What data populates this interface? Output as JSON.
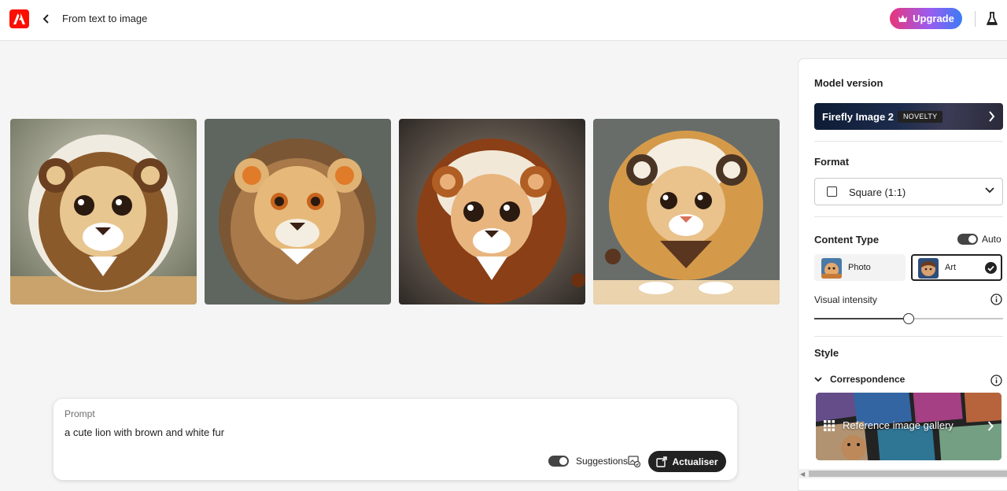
{
  "header": {
    "title": "From text to image",
    "upgrade_label": "Upgrade",
    "brand_color": "#fa0f00"
  },
  "gallery": {
    "images": [
      {
        "name": "lion-image-1"
      },
      {
        "name": "lion-image-2"
      },
      {
        "name": "lion-image-3"
      },
      {
        "name": "lion-image-4"
      }
    ]
  },
  "prompt": {
    "label": "Prompt",
    "value": "a cute lion with brown and white fur",
    "suggestions_label": "Suggestions",
    "suggestions_on": true,
    "refresh_label": "Actualiser"
  },
  "panel": {
    "model_version": {
      "title": "Model version",
      "model_name": "Firefly Image 2",
      "badge": "NOVELTY"
    },
    "format": {
      "title": "Format",
      "selected": "Square (1:1)"
    },
    "content_type": {
      "title": "Content Type",
      "auto_label": "Auto",
      "auto_on": true,
      "options": [
        {
          "label": "Photo",
          "selected": false
        },
        {
          "label": "Art",
          "selected": true
        }
      ]
    },
    "visual_intensity": {
      "label": "Visual intensity",
      "value_fraction": 0.5
    },
    "style": {
      "title": "Style",
      "section_label": "Correspondence",
      "gallery_label": "Reference image gallery"
    }
  }
}
